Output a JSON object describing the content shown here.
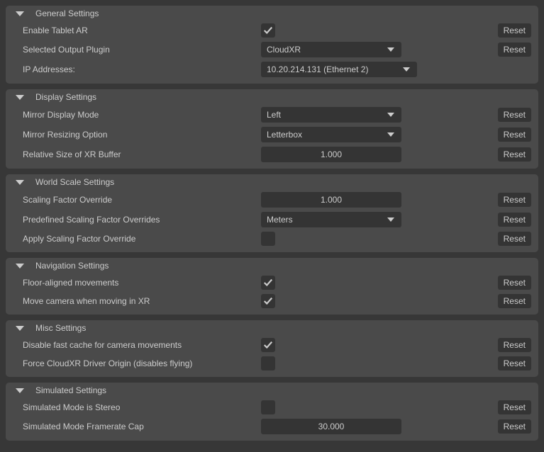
{
  "reset_label": "Reset",
  "sections": {
    "general": {
      "title": "General Settings",
      "rows": {
        "enable_tablet_ar": {
          "label": "Enable Tablet AR",
          "checked": true
        },
        "output_plugin": {
          "label": "Selected Output Plugin",
          "value": "CloudXR"
        },
        "ip_addresses": {
          "label": "IP Addresses:",
          "value": "10.20.214.131 (Ethernet 2)"
        }
      }
    },
    "display": {
      "title": "Display Settings",
      "rows": {
        "mirror_display_mode": {
          "label": "Mirror Display Mode",
          "value": "Left"
        },
        "mirror_resizing": {
          "label": "Mirror Resizing Option",
          "value": "Letterbox"
        },
        "xr_buffer_size": {
          "label": "Relative Size of XR Buffer",
          "value": "1.000"
        }
      }
    },
    "world_scale": {
      "title": "World Scale Settings",
      "rows": {
        "scaling_override": {
          "label": "Scaling Factor Override",
          "value": "1.000"
        },
        "predefined_overrides": {
          "label": "Predefined Scaling Factor Overrides",
          "value": "Meters"
        },
        "apply_override": {
          "label": "Apply Scaling Factor Override",
          "checked": false
        }
      }
    },
    "navigation": {
      "title": "Navigation Settings",
      "rows": {
        "floor_aligned": {
          "label": "Floor-aligned movements",
          "checked": true
        },
        "move_camera": {
          "label": "Move camera when moving in XR",
          "checked": true
        }
      }
    },
    "misc": {
      "title": "Misc Settings",
      "rows": {
        "disable_fast_cache": {
          "label": "Disable fast cache for camera movements",
          "checked": true
        },
        "force_cloudxr_origin": {
          "label": "Force CloudXR Driver Origin (disables flying)",
          "checked": false
        }
      }
    },
    "simulated": {
      "title": "Simulated Settings",
      "rows": {
        "stereo": {
          "label": "Simulated Mode is Stereo",
          "checked": false
        },
        "framerate_cap": {
          "label": "Simulated Mode Framerate Cap",
          "value": "30.000"
        }
      }
    }
  }
}
